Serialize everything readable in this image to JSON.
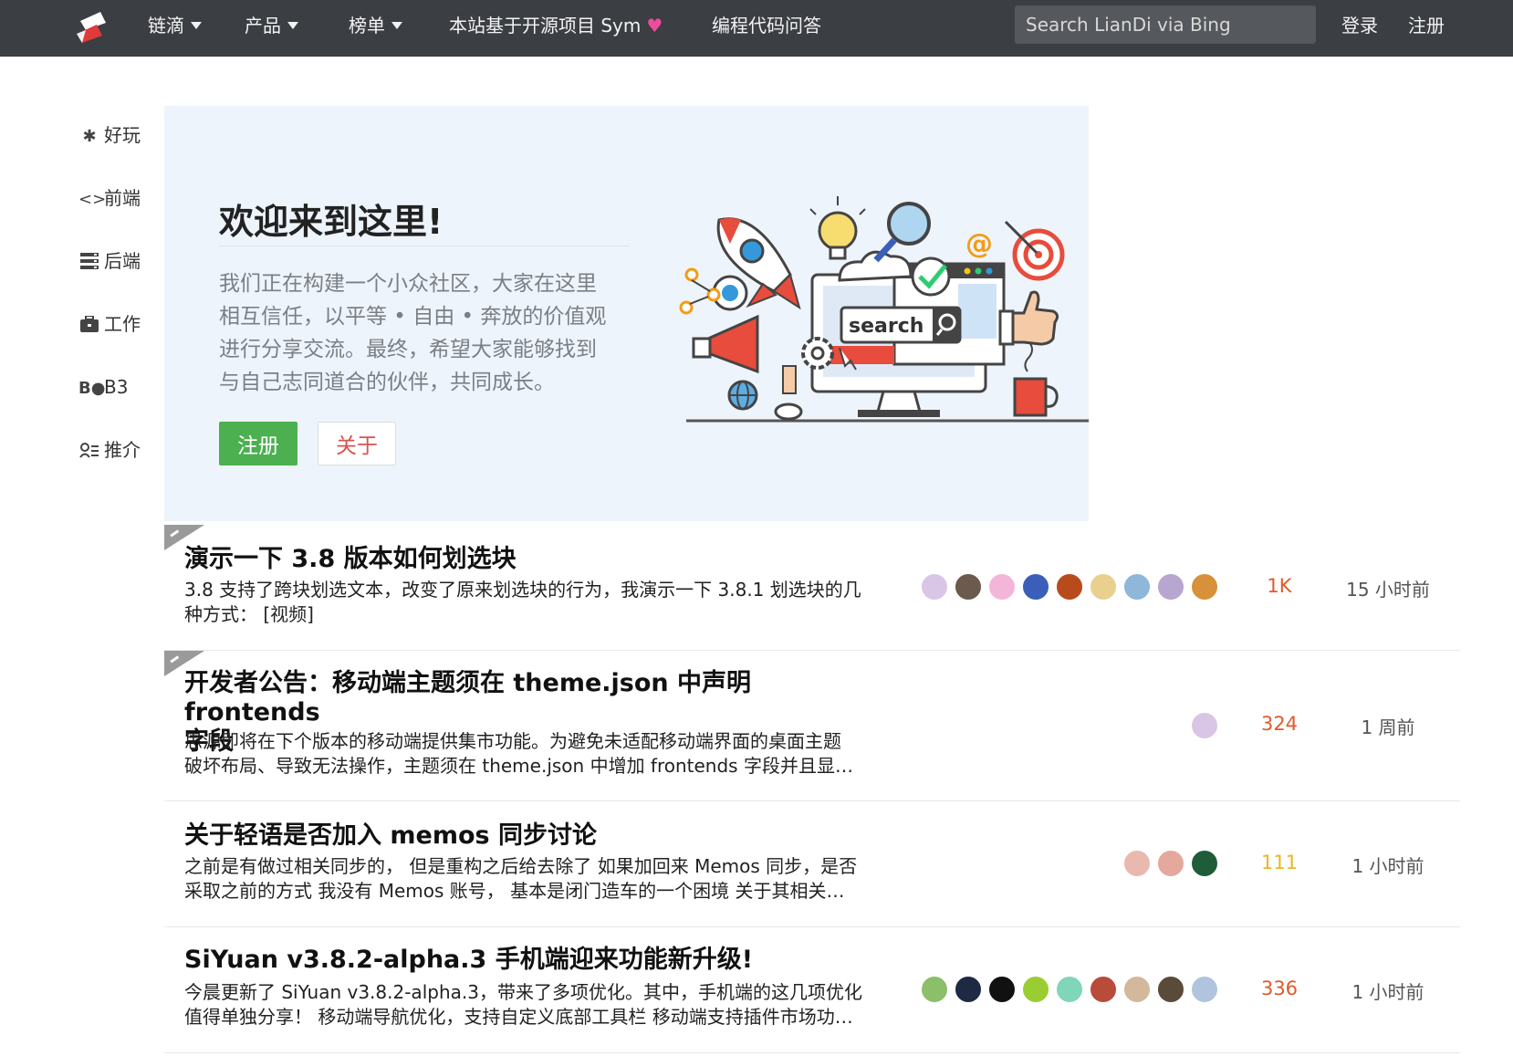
{
  "nav": {
    "items": [
      {
        "label": "链滴",
        "dropdown": true
      },
      {
        "label": "产品",
        "dropdown": true
      },
      {
        "label": "榜单",
        "dropdown": true
      },
      {
        "label": "本站基于开源项目 Sym",
        "dropdown": false
      },
      {
        "label": "编程代码问答",
        "dropdown": false
      }
    ],
    "search_placeholder": "Search LianDi via Bing",
    "login": "登录",
    "register": "注册"
  },
  "sidebar": {
    "items": [
      {
        "label": "好玩",
        "icon": "star-of-david-icon"
      },
      {
        "label": "前端",
        "icon": "code-icon"
      },
      {
        "label": "后端",
        "icon": "server-icon"
      },
      {
        "label": "工作",
        "icon": "briefcase-icon"
      },
      {
        "label": "B3",
        "icon": "b3-icon"
      },
      {
        "label": "推介",
        "icon": "id-card-icon"
      }
    ]
  },
  "hero": {
    "title": "欢迎来到这里!",
    "lines": [
      "我们正在构建一个小众社区，大家在这里",
      "相互信任，以平等 • 自由 • 奔放的价值观",
      "进行分享交流。最终，希望大家能够找到",
      "与自己志同道合的伙伴，共同成长。"
    ],
    "register": "注册",
    "about": "关于",
    "illustration_text": "search"
  },
  "articles": [
    {
      "pinned": true,
      "title_lines": [
        "演示一下 3.8 版本如何划选块"
      ],
      "excerpt_lines": [
        "3.8 支持了跨块划选文本，改变了原来划选块的行为，我演示一下 3.8.1 划选块的几",
        "种方式： [视频]"
      ],
      "count": "1K",
      "count_color": "#e05a2b",
      "time": "15 小时前",
      "avatar_colors": [
        "#d9c6e6",
        "#6b5a4d",
        "#f3b6d9",
        "#3b5fb8",
        "#b84b1c",
        "#e9d08f",
        "#8fb7d9",
        "#b7a6cf",
        "#d9903a"
      ]
    },
    {
      "pinned": true,
      "title_lines": [
        "开发者公告：移动端主题须在 theme.json 中声明 frontends",
        "字段"
      ],
      "excerpt_lines": [
        "思源即将在下个版本的移动端提供集市功能。为避免未适配移动端界面的桌面主题",
        "破坏布局、导致无法操作，主题须在 theme.json 中增加 frontends 字段并且显…"
      ],
      "count": "324",
      "count_color": "#e05a2b",
      "time": "1 周前",
      "avatar_colors": [
        "#d9c6e6"
      ]
    },
    {
      "pinned": false,
      "title_lines": [
        "关于轻语是否加入 memos 同步讨论"
      ],
      "excerpt_lines": [
        "之前是有做过相关同步的， 但是重构之后给去除了 如果加回来 Memos 同步，是否",
        "采取之前的方式 我没有 Memos 账号， 基本是闭门造车的一个困境 关于其相关…"
      ],
      "count": "111",
      "count_color": "#e8b820",
      "time": "1 小时前",
      "avatar_colors": [
        "#e9b9b0",
        "#e4a89c",
        "#1f5c3a"
      ]
    },
    {
      "pinned": false,
      "title_lines": [
        "SiYuan v3.8.2-alpha.3 手机端迎来功能新升级!"
      ],
      "excerpt_lines": [
        "今晨更新了 SiYuan v3.8.2-alpha.3，带来了多项优化。其中，手机端的这几项优化",
        "值得单独分享！ 移动端导航优化，支持自定义底部工具栏 移动端支持插件市场功…"
      ],
      "count": "336",
      "count_color": "#e05a2b",
      "time": "1 小时前",
      "avatar_colors": [
        "#8bbf6a",
        "#1e2a44",
        "#111111",
        "#9acd32",
        "#7fd6b8",
        "#b84b3a",
        "#d4b89c",
        "#5a4a3a",
        "#b0c4de"
      ]
    }
  ]
}
